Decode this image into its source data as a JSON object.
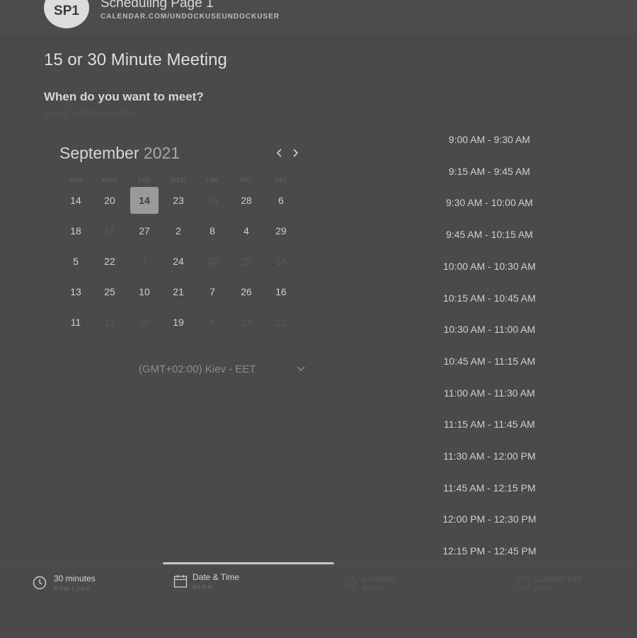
{
  "header": {
    "avatar": "SP1",
    "page_name": "Scheduling Page 1",
    "url": "CALENDAR.COM/UNDOCKUSEUNDOCKUSER"
  },
  "meeting": {
    "title": "15 or 30 Minute Meeting",
    "question": "When do you want to meet?",
    "subtitle": "Select a date and time"
  },
  "calendar": {
    "month": "September",
    "year": "2021",
    "weekdays": [
      "SUN",
      "MON",
      "TUE",
      "WED",
      "THU",
      "FRI",
      "SAT"
    ],
    "rows": [
      [
        {
          "d": "14"
        },
        {
          "d": "20"
        },
        {
          "d": "14",
          "sel": true
        },
        {
          "d": "23"
        },
        {
          "d": "15",
          "dim": true
        },
        {
          "d": "28"
        },
        {
          "d": "6"
        }
      ],
      [
        {
          "d": "18"
        },
        {
          "d": "17",
          "dim": true
        },
        {
          "d": "27"
        },
        {
          "d": "2"
        },
        {
          "d": "8"
        },
        {
          "d": "4"
        },
        {
          "d": "29"
        }
      ],
      [
        {
          "d": "5"
        },
        {
          "d": "22"
        },
        {
          "d": "1",
          "dim": true
        },
        {
          "d": "24"
        },
        {
          "d": "30",
          "dim": true
        },
        {
          "d": "25",
          "dim": true
        },
        {
          "d": "18",
          "dim": true
        }
      ],
      [
        {
          "d": "13"
        },
        {
          "d": "25"
        },
        {
          "d": "10"
        },
        {
          "d": "21"
        },
        {
          "d": "7"
        },
        {
          "d": "26"
        },
        {
          "d": "16"
        }
      ],
      [
        {
          "d": "11"
        },
        {
          "d": "11",
          "dim": true
        },
        {
          "d": "30",
          "dim": true
        },
        {
          "d": "19"
        },
        {
          "d": "6",
          "dim": true
        },
        {
          "d": "17",
          "dim": true
        },
        {
          "d": "22",
          "dim": true
        }
      ]
    ],
    "timezone": "(GMT+02:00) Kiev - EET"
  },
  "slots": [
    "9:00 AM - 9:30 AM",
    "9:15 AM - 9:45 AM",
    "9:30 AM - 10:00 AM",
    "9:45 AM - 10:15 AM",
    "10:00 AM - 10:30 AM",
    "10:15 AM - 10:45 AM",
    "10:30 AM - 11:00 AM",
    "10:45 AM - 11:15 AM",
    "11:00 AM - 11:30 AM",
    "11:15 AM - 11:45 AM",
    "11:30 AM - 12:00 PM",
    "11:45 AM - 12:15 PM",
    "12:00 PM - 12:30 PM",
    "12:15 PM - 12:45 PM"
  ],
  "steps": [
    {
      "label": "30 minutes",
      "sub": "HOW LONG",
      "icon": "clock-icon"
    },
    {
      "label": "Date & Time",
      "sub": "WHEN",
      "icon": "calendar-icon"
    },
    {
      "label": "Location",
      "sub": "WHERE",
      "icon": "location-icon"
    },
    {
      "label": "Confirm Info",
      "sub": "WHO",
      "icon": "confirm-icon"
    }
  ]
}
